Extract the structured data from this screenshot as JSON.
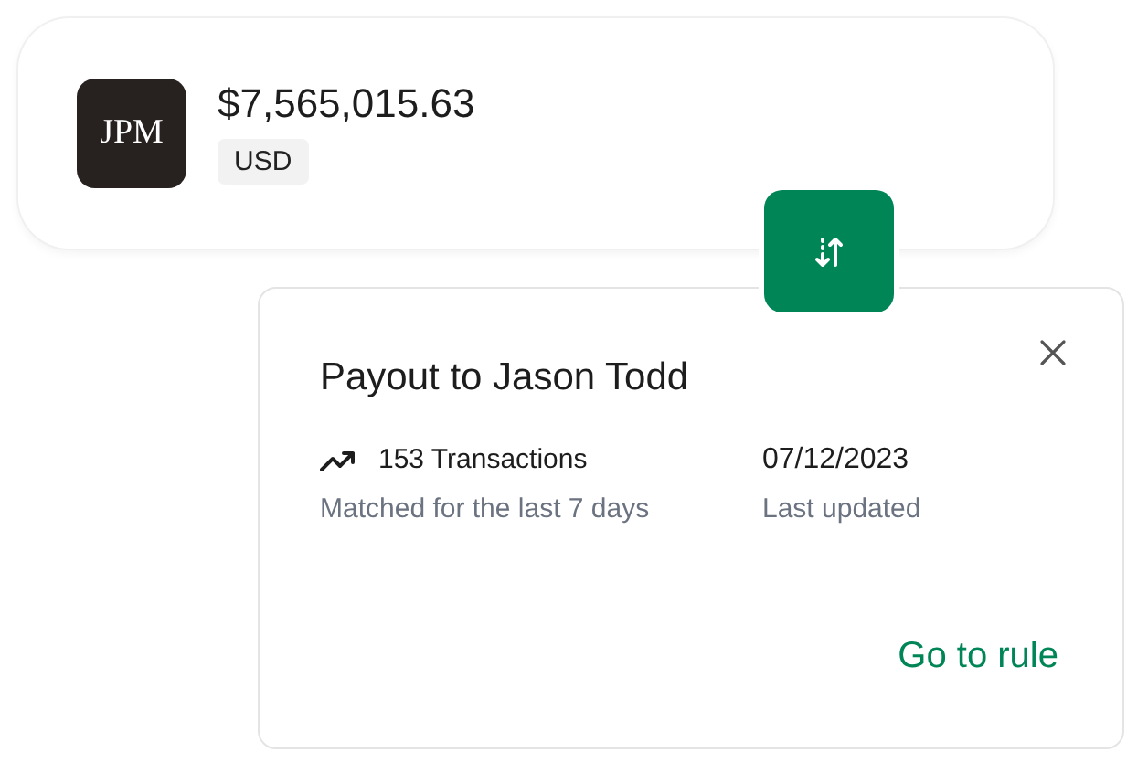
{
  "account": {
    "logo": "JPM",
    "balance": "$7,565,015.63",
    "currency": "USD"
  },
  "rule": {
    "title": "Payout to Jason Todd",
    "stats": [
      {
        "kind": "trend",
        "value": "153 Transactions",
        "caption": "Matched for the last 7 days"
      },
      {
        "kind": "plain",
        "value": "07/12/2023",
        "caption": "Last updated"
      }
    ],
    "action": "Go to rule"
  }
}
